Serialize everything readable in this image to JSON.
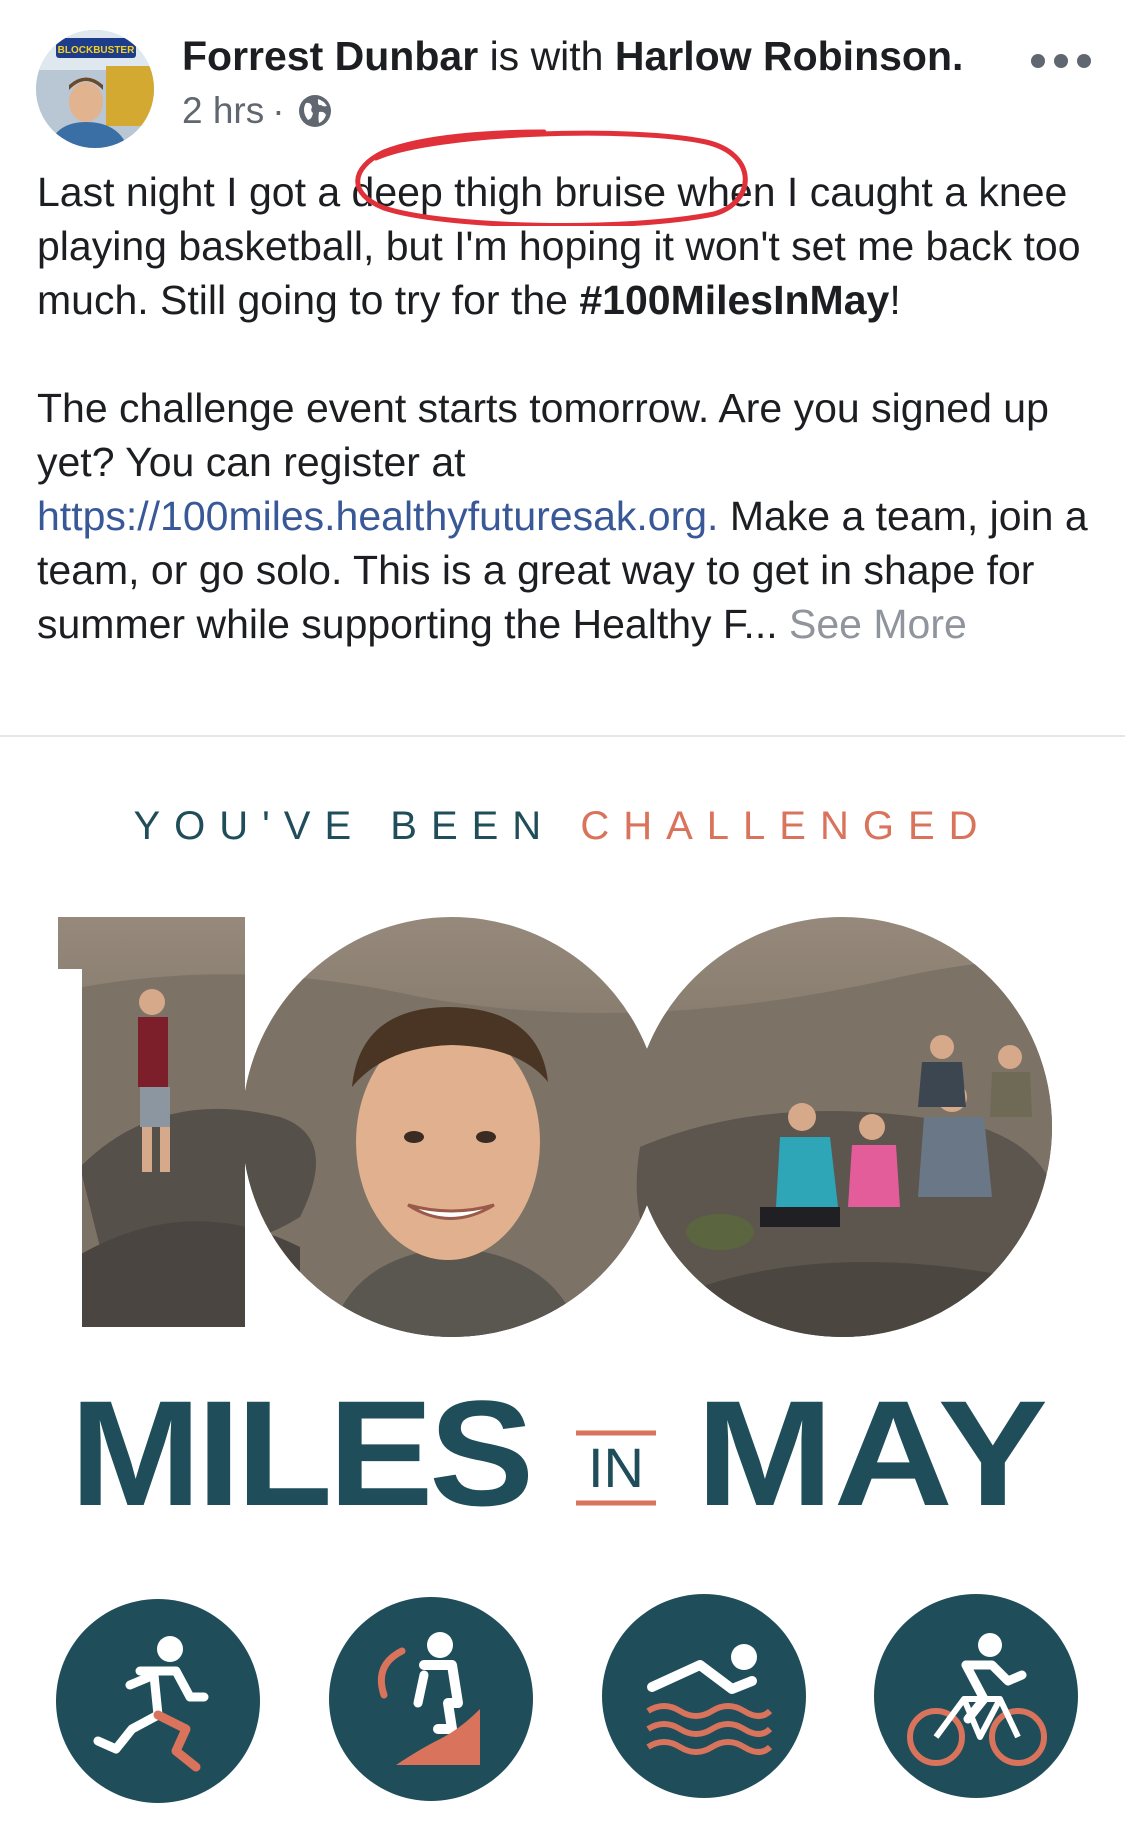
{
  "post": {
    "author": "Forrest Dunbar",
    "with_text": "is with",
    "tagged": "Harlow Robinson.",
    "time": "2 hrs",
    "separator": "·",
    "privacy_icon": "globe-icon",
    "more_icon": "more-horizontal-icon",
    "avatar_sign": "BLOCKBUSTER",
    "body": {
      "p1_before": "Last night I got a ",
      "p1_highlight": "deep thigh bruise",
      "p1_after": " when I caught a knee playing basketball, but I'm hoping it won't set me back too much. Still going to try for the ",
      "hashtag": "#100MilesInMay",
      "p1_end": "!",
      "p2_before": "The challenge event starts tomorrow. Are you signed up yet?  You can register at ",
      "link": "https://100miles.healthyfuturesak.org.",
      "p2_after": "  Make a team, join a team, or go solo. This is a great way to get in shape for summer while supporting the Healthy F...",
      "see_more": "See More"
    },
    "annotation_color": "#e0303a"
  },
  "promo": {
    "line_dark": "YOU'VE  BEEN",
    "line_accent": "CHALLENGED",
    "number": "100",
    "miles": "MILES",
    "in": "IN",
    "may": "MAY",
    "colors": {
      "teal": "#1f4e5a",
      "coral": "#d9735b"
    },
    "activities": [
      "running-icon",
      "hiking-icon",
      "swimming-icon",
      "cycling-icon"
    ]
  }
}
